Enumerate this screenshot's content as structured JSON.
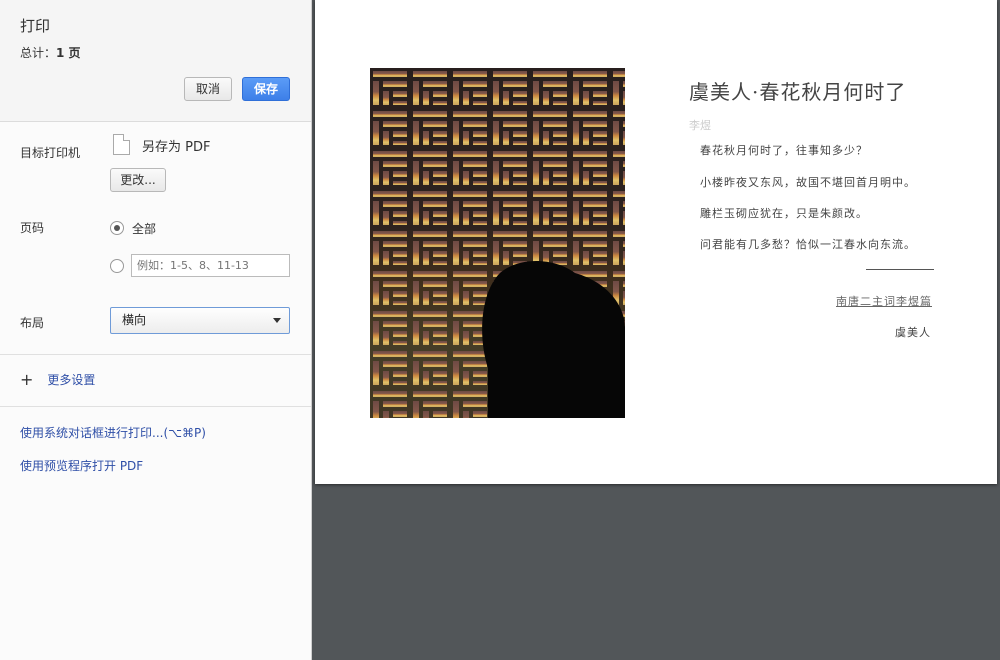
{
  "header": {
    "title": "打印",
    "total_prefix": "总计：",
    "total_count": "1 页",
    "cancel_label": "取消",
    "save_label": "保存"
  },
  "destination": {
    "label": "目标打印机",
    "icon": "pdf-file-icon",
    "value": "另存为 PDF",
    "change_label": "更改..."
  },
  "pages": {
    "label": "页码",
    "all_label": "全部",
    "selected": "all",
    "custom_placeholder": "例如：1-5、8、11-13"
  },
  "layout": {
    "label": "布局",
    "value": "横向"
  },
  "more": {
    "icon": "plus-icon",
    "label": "更多设置"
  },
  "links": {
    "system_dialog": "使用系统对话框进行打印...(⌥⌘P)",
    "open_preview": "使用预览程序打开 PDF"
  },
  "preview": {
    "title": "虞美人·春花秋月何时了",
    "author": "李煜",
    "lines": [
      "春花秋月何时了，往事知多少？",
      "小楼昨夜又东风，故国不堪回首月明中。",
      "雕栏玉砌应犹在，只是朱颜改。",
      "问君能有几多愁？恰似一江春水向东流。"
    ],
    "collection": "南唐二主词李煜篇",
    "tune": "虞美人"
  },
  "colors": {
    "accent": "#3d7fe8",
    "link": "#2f4fa7",
    "preview_bg": "#525659"
  }
}
